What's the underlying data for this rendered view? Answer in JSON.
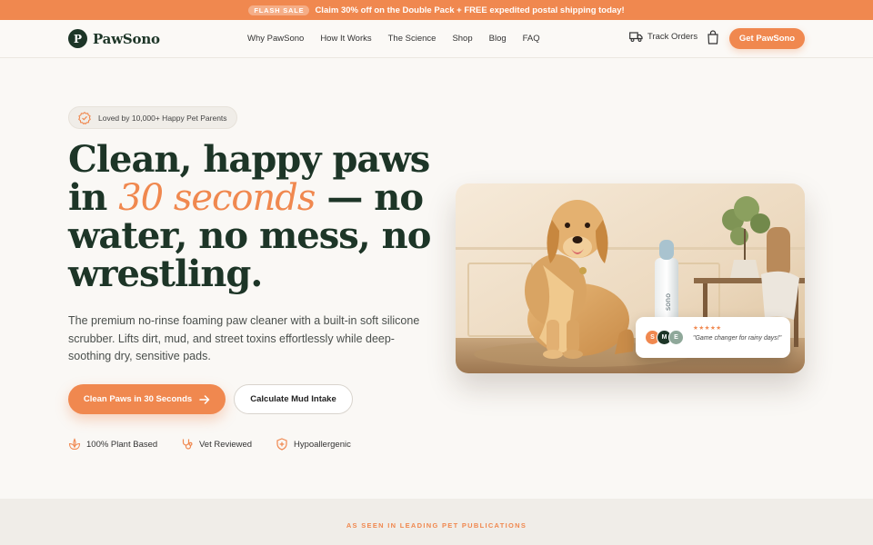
{
  "promo": {
    "badge": "FLASH SALE",
    "text": "Claim 30% off on the Double Pack + FREE expedited postal shipping today!"
  },
  "brand": {
    "initial": "P",
    "name": "PawSono"
  },
  "nav": {
    "links": [
      "Why PawSono",
      "How It Works",
      "The Science",
      "Shop",
      "Blog",
      "FAQ"
    ],
    "track_label": "Track Orders",
    "cta": "Get PawSono"
  },
  "hero": {
    "pill": "Loved by 10,000+ Happy Pet Parents",
    "headline_part1": "Clean, happy paws in",
    "headline_accent": "30 seconds",
    "headline_part2": "— no water, no mess, no wrestling.",
    "subtext": "The premium no-rinse foaming paw cleaner with a built-in soft silicone scrubber. Lifts dirt, mud, and street toxins effortlessly while deep-soothing dry, sensitive pads.",
    "primary_cta": "Clean Paws in 30 Seconds",
    "secondary_cta": "Calculate Mud Intake",
    "trust": [
      "100% Plant Based",
      "Vet Reviewed",
      "Hypoallergenic"
    ]
  },
  "review_card": {
    "avatars": [
      "S",
      "M",
      "E"
    ],
    "stars": "★★★★★",
    "rating": 5,
    "quote": "\"Game changer for rainy days!\""
  },
  "bottle_label": "sono",
  "press": {
    "title": "AS SEEN IN LEADING PET PUBLICATIONS"
  },
  "colors": {
    "accent": "#f0884f",
    "brand_dark": "#1d3527",
    "background": "#faf8f5"
  }
}
